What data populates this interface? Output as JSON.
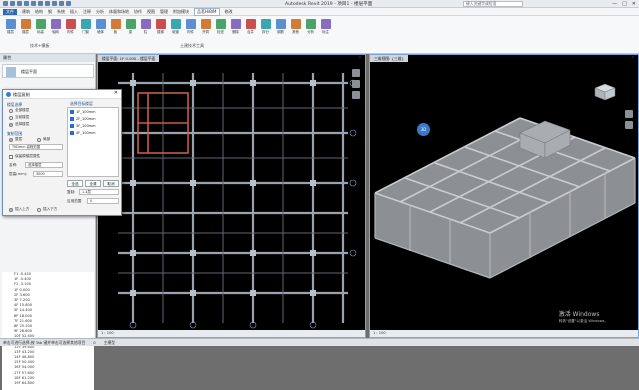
{
  "window": {
    "app_title": "Autodesk Revit 2019 -",
    "doc_title": "项目1 - 楼层平面",
    "search_placeholder": "键入关键字或短语",
    "min": "—",
    "max": "□",
    "close": "✕"
  },
  "menu": [
    "文件",
    "建筑",
    "结构",
    "钢",
    "系统",
    "插入",
    "注释",
    "分析",
    "体量和场地",
    "协作",
    "视图",
    "管理",
    "附加模块",
    "品茗HiBIM",
    "修改"
  ],
  "menu_active": "品茗HiBIM",
  "ribbon": {
    "groups": [
      {
        "label": "技术+模板"
      },
      {
        "label": "土建技术工具"
      }
    ],
    "buttons": [
      "楼层",
      "楼层",
      "标高",
      "轴网",
      "构件",
      "门窗",
      "墙体",
      "板",
      "梁",
      "柱",
      "楼梯",
      "坡道",
      "构件",
      "开洞",
      "检查",
      "删除",
      "合并",
      "拆分",
      "钢筋",
      "其他",
      "分析",
      "标注"
    ]
  },
  "properties": {
    "title": "属性",
    "type": "楼层平面"
  },
  "levels": [
    "F1 -0.450",
    "1F -5.400",
    "F2 -3.100",
    "1F 0.000",
    "2F 3.600",
    "3F 7.200",
    "4F 10.800",
    "5F 14.400",
    "6F 18.000",
    "7F 21.600",
    "8F 25.200",
    "9F 28.800",
    "10F 32.400",
    "11F 36.000",
    "12F 39.600",
    "13F 43.200",
    "14F 46.800",
    "15F 50.400",
    "16F 54.000",
    "17F 57.600",
    "18F 61.200",
    "19F 64.800"
  ],
  "dialog": {
    "title": "楼层复制",
    "close": "✕",
    "sect_source": "楼层选择",
    "opt_all": "全部楼层",
    "opt_current": "当前楼层",
    "opt_select": "选择楼层",
    "sect_range": "复制范围",
    "opt_whole": "整层",
    "opt_partial": "局部",
    "field_range": "TKDmm 高程范围",
    "chk_keep": "保留原楼层属性",
    "label_start": "名称:",
    "field_start": "选择楼层",
    "label_height": "层高(mm):",
    "field_height": "3000",
    "opt_insert_above": "插入上方",
    "opt_insert_below": "插入下方",
    "list_title": "选择目标楼层",
    "list_items": [
      "1F_100mm",
      "2F_100mm",
      "3F_100mm",
      "4F_100mm"
    ],
    "btn_ok": "全选",
    "btn_clear": "全清",
    "btn_cancel": "取消",
    "label_copy": "复制:",
    "field_copy": "1-4层",
    "label_apply": "应用范围",
    "field_apply": "0"
  },
  "view2d": {
    "tab": "楼层平面: 1F 0.000 - 楼层平面",
    "scale_bar": "1 : 100"
  },
  "view3d": {
    "tab": "三维视图: {三维}",
    "scale_bar": "1 : 100",
    "marker": "3D"
  },
  "watermark": {
    "line1": "激活 Windows",
    "line2": "转到\"设置\"以激活 Windows。"
  },
  "status": {
    "left": "单击可进行选择;按 Tab 键并单击可选择其他项目",
    "model": "主模型",
    "zero": "0"
  }
}
